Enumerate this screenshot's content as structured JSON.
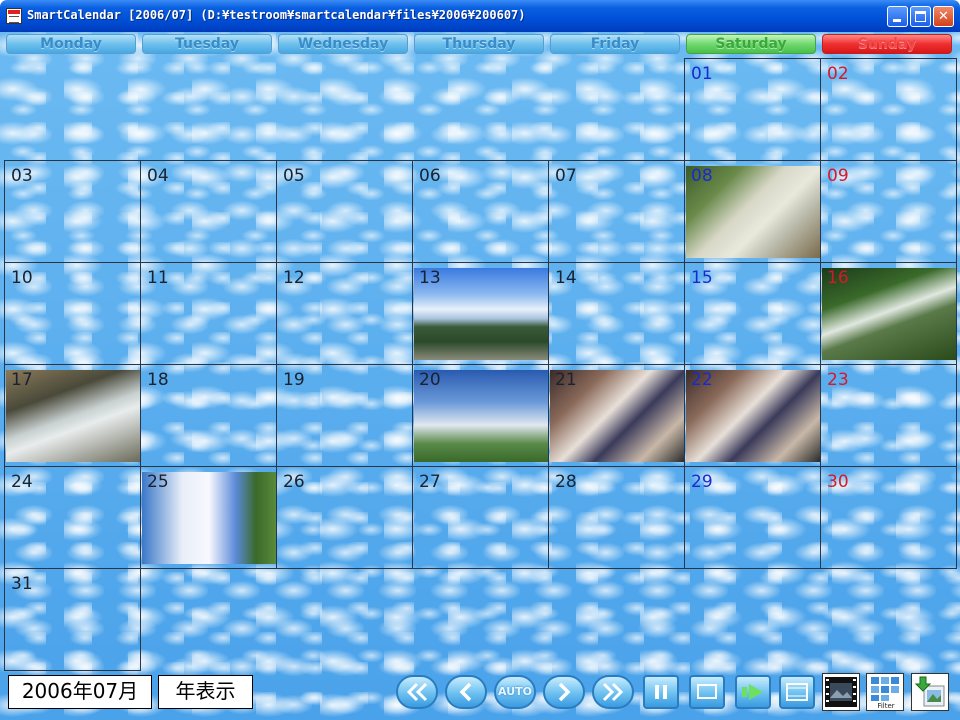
{
  "window": {
    "title": "SmartCalendar [2006/07] (D:¥testroom¥smartcalendar¥files¥2006¥200607)",
    "app_icon": "smart-calendar-icon"
  },
  "weekdays": [
    "Monday",
    "Tuesday",
    "Wednesday",
    "Thursday",
    "Friday",
    "Saturday",
    "Sunday"
  ],
  "weeks": [
    [
      null,
      null,
      null,
      null,
      null,
      {
        "day": "01"
      },
      {
        "day": "02"
      }
    ],
    [
      {
        "day": "03"
      },
      {
        "day": "04"
      },
      {
        "day": "05"
      },
      {
        "day": "06"
      },
      {
        "day": "07"
      },
      {
        "day": "08",
        "photo": "japanese-sweets"
      },
      {
        "day": "09"
      }
    ],
    [
      {
        "day": "10"
      },
      {
        "day": "11"
      },
      {
        "day": "12"
      },
      {
        "day": "13",
        "photo": "mountain-landscape"
      },
      {
        "day": "14"
      },
      {
        "day": "15"
      },
      {
        "day": "16",
        "photo": "waterfall"
      }
    ],
    [
      {
        "day": "17",
        "photo": "water-channel"
      },
      {
        "day": "18"
      },
      {
        "day": "19"
      },
      {
        "day": "20",
        "photo": "sky-landscape"
      },
      {
        "day": "21",
        "photo": "festival-people"
      },
      {
        "day": "22",
        "photo": "festival-people"
      },
      {
        "day": "23"
      }
    ],
    [
      {
        "day": "24"
      },
      {
        "day": "25",
        "photo": "cumulus-clouds"
      },
      {
        "day": "26"
      },
      {
        "day": "27"
      },
      {
        "day": "28"
      },
      {
        "day": "29"
      },
      {
        "day": "30"
      }
    ],
    [
      {
        "day": "31"
      },
      null,
      null,
      null,
      null,
      null,
      null
    ]
  ],
  "footer": {
    "month_label": "2006年07月",
    "year_view_label": "年表示",
    "controls": [
      "rewind-icon",
      "previous-icon",
      "auto-icon",
      "next-icon",
      "fast-forward-icon",
      "pause-icon",
      "screen-icon",
      "play-icon",
      "film-icon",
      "slideshow-icon",
      "filter-icon",
      "export-icon"
    ],
    "auto_label": "AUTO",
    "filter_label": "Filter"
  },
  "colors": {
    "saturday": "#1a2ad0",
    "sunday": "#d81828",
    "weekday": "#1a2230",
    "sky": "#57aef0"
  }
}
